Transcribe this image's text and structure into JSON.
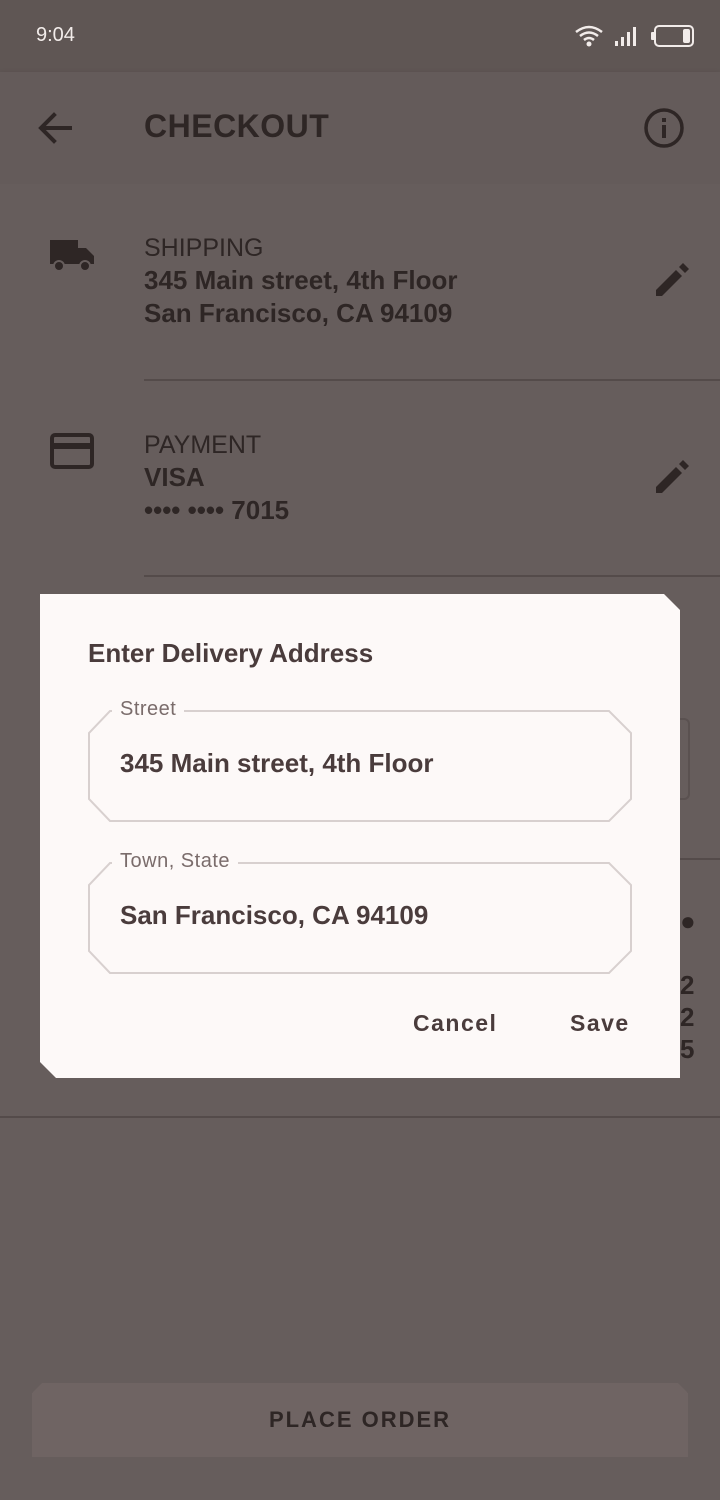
{
  "status_bar": {
    "time": "9:04"
  },
  "app_bar": {
    "title": "CHECKOUT"
  },
  "shipping": {
    "label": "SHIPPING",
    "line1": "345 Main street, 4th Floor",
    "line2": "San Francisco, CA 94109"
  },
  "payment": {
    "label": "PAYMENT",
    "card_type": "VISA",
    "card_number": "•••• •••• 7015"
  },
  "dialog": {
    "title": "Enter Delivery Address",
    "street_label": "Street",
    "street_value": "345 Main street, 4th Floor",
    "town_label": "Town, State",
    "town_value": "San Francisco, CA 94109",
    "cancel_label": "Cancel",
    "save_label": "Save"
  },
  "footer": {
    "place_order_label": "PLACE ORDER"
  },
  "colors": {
    "scrim_background": "#665d5c",
    "dialog_surface": "#fdf9f8",
    "primary_text": "#4a3c3c",
    "dark_text": "#2e2625"
  }
}
